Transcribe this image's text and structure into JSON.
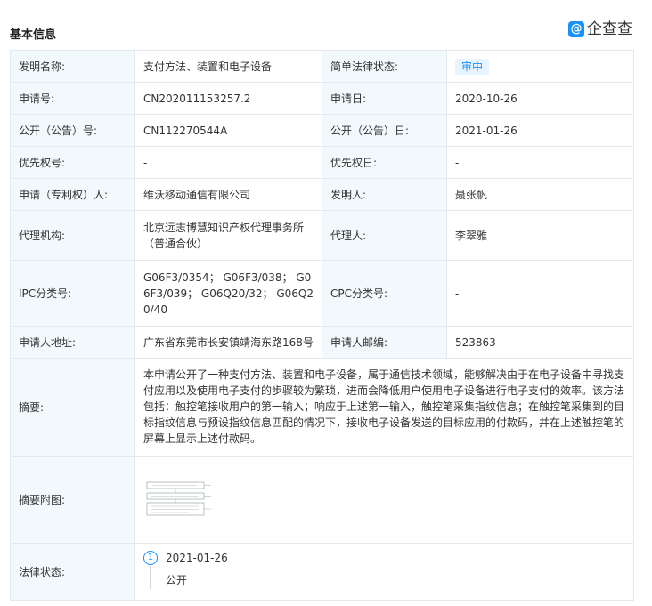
{
  "header": {
    "title": "基本信息",
    "logo_text": "企查查",
    "logo_mark": "@"
  },
  "rows": {
    "invention_name": {
      "label": "发明名称:",
      "value": "支付方法、装置和电子设备"
    },
    "legal_status_brief": {
      "label": "简单法律状态:",
      "value": "审中"
    },
    "application_no": {
      "label": "申请号:",
      "value": "CN202011153257.2"
    },
    "application_date": {
      "label": "申请日:",
      "value": "2020-10-26"
    },
    "publication_no": {
      "label": "公开（公告）号:",
      "value": "CN112270544A"
    },
    "publication_date": {
      "label": "公开（公告）日:",
      "value": "2021-01-26"
    },
    "priority_no": {
      "label": "优先权号:",
      "value": "-"
    },
    "priority_date": {
      "label": "优先权日:",
      "value": "-"
    },
    "applicant": {
      "label": "申请（专利权）人:",
      "value": "维沃移动通信有限公司"
    },
    "inventor": {
      "label": "发明人:",
      "value": "聂张帆"
    },
    "agency": {
      "label": "代理机构:",
      "value": "北京远志博慧知识产权代理事务所（普通合伙）"
    },
    "agent": {
      "label": "代理人:",
      "value": "李翠雅"
    },
    "ipc": {
      "label": "IPC分类号:",
      "value": "G06F3/0354； G06F3/038； G06F3/039； G06Q20/32； G06Q20/40"
    },
    "cpc": {
      "label": "CPC分类号:",
      "value": "-"
    },
    "address": {
      "label": "申请人地址:",
      "value": "广东省东莞市长安镇靖海东路168号"
    },
    "postcode": {
      "label": "申请人邮编:",
      "value": "523863"
    },
    "abstract": {
      "label": "摘要:",
      "value": "本申请公开了一种支付方法、装置和电子设备，属于通信技术领域，能够解决由于在电子设备中寻找支付应用以及使用电子支付的步骤较为繁琐，进而会降低用户使用电子设备进行电子支付的效率。该方法包括：触控笔接收用户的第一输入；响应于上述第一输入，触控笔采集指纹信息；在触控笔采集到的目标指纹信息与预设指纹信息匹配的情况下，接收电子设备发送的目标应用的付款码，并在上述触控笔的屏幕上显示上述付款码。"
    },
    "abstract_figure": {
      "label": "摘要附图:"
    },
    "legal_status": {
      "label": "法律状态:",
      "events": [
        {
          "index": "1",
          "date": "2021-01-26",
          "status": "公开"
        }
      ]
    }
  },
  "colors": {
    "label_bg": "#f2f9fc",
    "border": "#e4e8ef",
    "link": "#1676cf",
    "accent": "#1890ff"
  }
}
